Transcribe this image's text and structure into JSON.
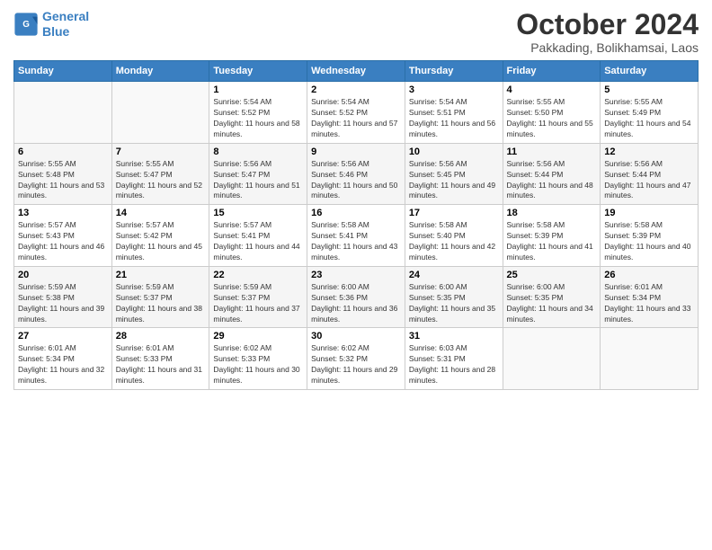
{
  "logo": {
    "line1": "General",
    "line2": "Blue"
  },
  "title": "October 2024",
  "subtitle": "Pakkading, Bolikhamsai, Laos",
  "headers": [
    "Sunday",
    "Monday",
    "Tuesday",
    "Wednesday",
    "Thursday",
    "Friday",
    "Saturday"
  ],
  "weeks": [
    [
      {
        "day": "",
        "info": ""
      },
      {
        "day": "",
        "info": ""
      },
      {
        "day": "1",
        "info": "Sunrise: 5:54 AM\nSunset: 5:52 PM\nDaylight: 11 hours and 58 minutes."
      },
      {
        "day": "2",
        "info": "Sunrise: 5:54 AM\nSunset: 5:52 PM\nDaylight: 11 hours and 57 minutes."
      },
      {
        "day": "3",
        "info": "Sunrise: 5:54 AM\nSunset: 5:51 PM\nDaylight: 11 hours and 56 minutes."
      },
      {
        "day": "4",
        "info": "Sunrise: 5:55 AM\nSunset: 5:50 PM\nDaylight: 11 hours and 55 minutes."
      },
      {
        "day": "5",
        "info": "Sunrise: 5:55 AM\nSunset: 5:49 PM\nDaylight: 11 hours and 54 minutes."
      }
    ],
    [
      {
        "day": "6",
        "info": "Sunrise: 5:55 AM\nSunset: 5:48 PM\nDaylight: 11 hours and 53 minutes."
      },
      {
        "day": "7",
        "info": "Sunrise: 5:55 AM\nSunset: 5:47 PM\nDaylight: 11 hours and 52 minutes."
      },
      {
        "day": "8",
        "info": "Sunrise: 5:56 AM\nSunset: 5:47 PM\nDaylight: 11 hours and 51 minutes."
      },
      {
        "day": "9",
        "info": "Sunrise: 5:56 AM\nSunset: 5:46 PM\nDaylight: 11 hours and 50 minutes."
      },
      {
        "day": "10",
        "info": "Sunrise: 5:56 AM\nSunset: 5:45 PM\nDaylight: 11 hours and 49 minutes."
      },
      {
        "day": "11",
        "info": "Sunrise: 5:56 AM\nSunset: 5:44 PM\nDaylight: 11 hours and 48 minutes."
      },
      {
        "day": "12",
        "info": "Sunrise: 5:56 AM\nSunset: 5:44 PM\nDaylight: 11 hours and 47 minutes."
      }
    ],
    [
      {
        "day": "13",
        "info": "Sunrise: 5:57 AM\nSunset: 5:43 PM\nDaylight: 11 hours and 46 minutes."
      },
      {
        "day": "14",
        "info": "Sunrise: 5:57 AM\nSunset: 5:42 PM\nDaylight: 11 hours and 45 minutes."
      },
      {
        "day": "15",
        "info": "Sunrise: 5:57 AM\nSunset: 5:41 PM\nDaylight: 11 hours and 44 minutes."
      },
      {
        "day": "16",
        "info": "Sunrise: 5:58 AM\nSunset: 5:41 PM\nDaylight: 11 hours and 43 minutes."
      },
      {
        "day": "17",
        "info": "Sunrise: 5:58 AM\nSunset: 5:40 PM\nDaylight: 11 hours and 42 minutes."
      },
      {
        "day": "18",
        "info": "Sunrise: 5:58 AM\nSunset: 5:39 PM\nDaylight: 11 hours and 41 minutes."
      },
      {
        "day": "19",
        "info": "Sunrise: 5:58 AM\nSunset: 5:39 PM\nDaylight: 11 hours and 40 minutes."
      }
    ],
    [
      {
        "day": "20",
        "info": "Sunrise: 5:59 AM\nSunset: 5:38 PM\nDaylight: 11 hours and 39 minutes."
      },
      {
        "day": "21",
        "info": "Sunrise: 5:59 AM\nSunset: 5:37 PM\nDaylight: 11 hours and 38 minutes."
      },
      {
        "day": "22",
        "info": "Sunrise: 5:59 AM\nSunset: 5:37 PM\nDaylight: 11 hours and 37 minutes."
      },
      {
        "day": "23",
        "info": "Sunrise: 6:00 AM\nSunset: 5:36 PM\nDaylight: 11 hours and 36 minutes."
      },
      {
        "day": "24",
        "info": "Sunrise: 6:00 AM\nSunset: 5:35 PM\nDaylight: 11 hours and 35 minutes."
      },
      {
        "day": "25",
        "info": "Sunrise: 6:00 AM\nSunset: 5:35 PM\nDaylight: 11 hours and 34 minutes."
      },
      {
        "day": "26",
        "info": "Sunrise: 6:01 AM\nSunset: 5:34 PM\nDaylight: 11 hours and 33 minutes."
      }
    ],
    [
      {
        "day": "27",
        "info": "Sunrise: 6:01 AM\nSunset: 5:34 PM\nDaylight: 11 hours and 32 minutes."
      },
      {
        "day": "28",
        "info": "Sunrise: 6:01 AM\nSunset: 5:33 PM\nDaylight: 11 hours and 31 minutes."
      },
      {
        "day": "29",
        "info": "Sunrise: 6:02 AM\nSunset: 5:33 PM\nDaylight: 11 hours and 30 minutes."
      },
      {
        "day": "30",
        "info": "Sunrise: 6:02 AM\nSunset: 5:32 PM\nDaylight: 11 hours and 29 minutes."
      },
      {
        "day": "31",
        "info": "Sunrise: 6:03 AM\nSunset: 5:31 PM\nDaylight: 11 hours and 28 minutes."
      },
      {
        "day": "",
        "info": ""
      },
      {
        "day": "",
        "info": ""
      }
    ]
  ]
}
